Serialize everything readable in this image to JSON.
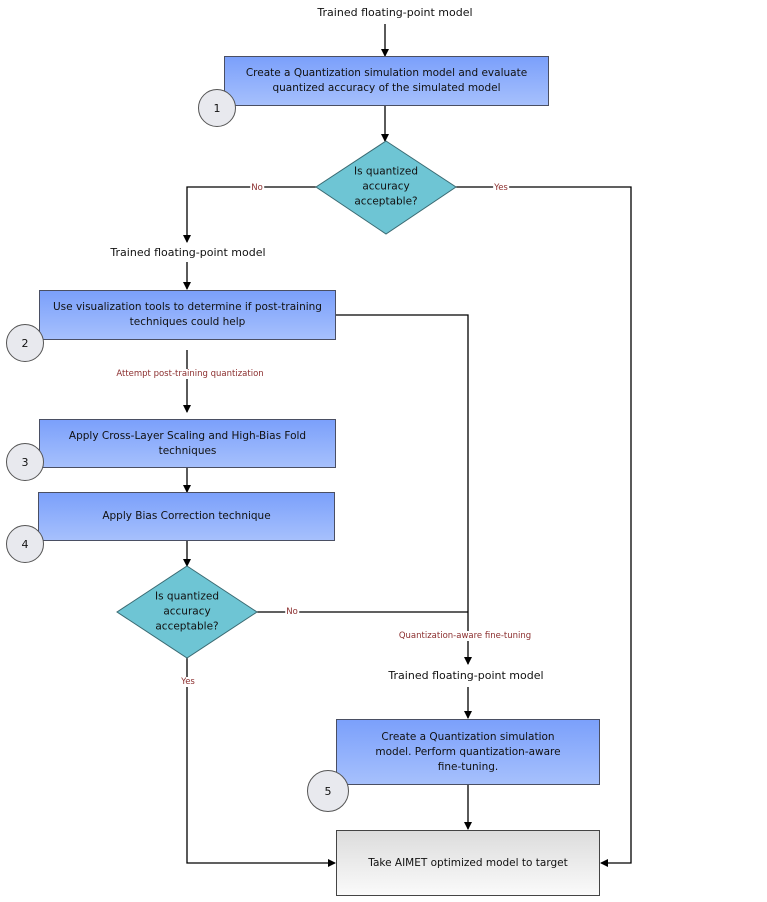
{
  "flow": {
    "start_label": "Trained floating-point model",
    "step1": {
      "number": "1",
      "text": "Create a Quantization simulation model and evaluate quantized accuracy of the simulated model"
    },
    "decision1": {
      "text": "Is quantized accuracy acceptable?",
      "no": "No",
      "yes": "Yes"
    },
    "model_label_2": "Trained floating-point model",
    "step2": {
      "number": "2",
      "text": "Use visualization tools to determine if post-training techniques could help"
    },
    "attempt_ptq": "Attempt post-training quantization",
    "step3": {
      "number": "3",
      "text": "Apply Cross-Layer Scaling and High-Bias Fold techniques"
    },
    "step4": {
      "number": "4",
      "text": "Apply Bias Correction technique"
    },
    "decision2": {
      "text": "Is quantized accuracy acceptable?",
      "no": "No",
      "yes": "Yes"
    },
    "qat_label": "Quantization-aware fine-tuning",
    "model_label_3": "Trained floating-point model",
    "step5": {
      "number": "5",
      "text": "Create a Quantization simulation model. Perform quantization-aware fine-tuning."
    },
    "final": {
      "text": "Take AIMET optimized model to target"
    }
  },
  "colors": {
    "box_top": "#7ba0fb",
    "box_bottom": "#a6c0fc",
    "diamond": "#6ec5d4",
    "edge_label": "#8b2e2e",
    "final_top": "#dcdcdc",
    "final_bottom": "#fafafa"
  }
}
